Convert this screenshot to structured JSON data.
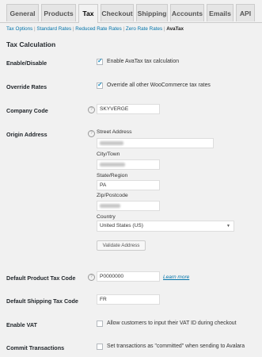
{
  "tabs": [
    {
      "label": "General"
    },
    {
      "label": "Products"
    },
    {
      "label": "Tax",
      "active": true
    },
    {
      "label": "Checkout"
    },
    {
      "label": "Shipping"
    },
    {
      "label": "Accounts"
    },
    {
      "label": "Emails"
    },
    {
      "label": "API"
    }
  ],
  "subnav": {
    "items": [
      "Tax Options",
      "Standard Rates",
      "Reduced Rate Rates",
      "Zero Rate Rates",
      "AvaTax"
    ],
    "separator": "|"
  },
  "section_title": "Tax Calculation",
  "enable": {
    "label": "Enable/Disable",
    "checkbox_text": "Enable AvaTax tax calculation",
    "checked": true
  },
  "override": {
    "label": "Override Rates",
    "checkbox_text": "Override all other WooCommerce tax rates",
    "checked": true
  },
  "company_code": {
    "label": "Company Code",
    "value": "SKYVERGE"
  },
  "origin": {
    "label": "Origin Address",
    "street_label": "Street Address",
    "city_label": "City/Town",
    "state_label": "State/Region",
    "state_value": "PA",
    "zip_label": "Zip/Postcode",
    "country_label": "Country",
    "country_value": "United States (US)",
    "validate_button": "Validate Address"
  },
  "product_tax": {
    "label": "Default Product Tax Code",
    "value": "P0000000",
    "link": "Learn more"
  },
  "shipping_tax": {
    "label": "Default Shipping Tax Code",
    "value": "FR"
  },
  "vat": {
    "label": "Enable VAT",
    "checkbox_text": "Allow customers to input their VAT ID during checkout",
    "checked": false
  },
  "commit": {
    "label": "Commit Transactions",
    "checkbox_text": "Set transactions as \"committed\" when sending to Avalara",
    "checked": false
  },
  "icons": {
    "help": "help-icon",
    "dropdown": "chevron-down-icon"
  }
}
